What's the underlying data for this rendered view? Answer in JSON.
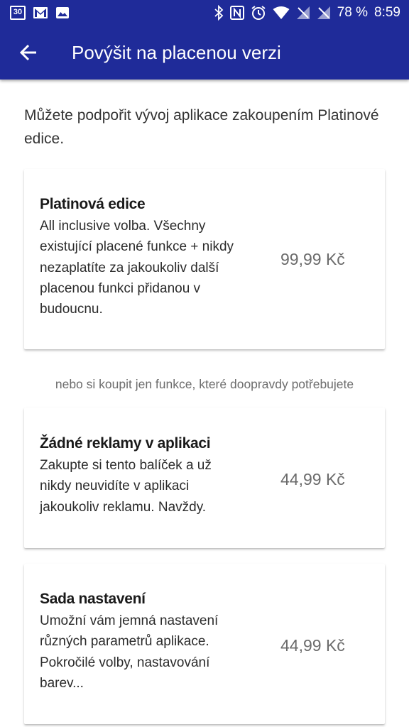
{
  "status_bar": {
    "calendar_day": "30",
    "icons_left": [
      "calendar-icon",
      "gmail-icon",
      "image-icon"
    ],
    "icons_right": [
      "bluetooth-icon",
      "nfc-icon",
      "alarm-icon",
      "wifi-icon",
      "signal-icon",
      "signal-icon",
      "battery-icon"
    ],
    "battery": "78 %",
    "time": "8:59"
  },
  "toolbar": {
    "back_icon": "arrow-back-icon",
    "title": "Povýšit na placenou verzi"
  },
  "intro_text": "Můžete podpořit vývoj aplikace zakoupením Platinové edice.",
  "separator_text": "nebo si koupit jen funkce, které doopravdy potřebujete",
  "products": [
    {
      "title": "Platinová edice",
      "description": "All inclusive volba. Všechny existující placené funkce + nikdy nezaplatíte za jakoukoliv další placenou funkci přidanou v budoucnu.",
      "price": "99,99 Kč"
    },
    {
      "title": "Žádné reklamy v aplikaci",
      "description": "Zakupte si tento balíček a už nikdy neuvidíte v aplikaci jakoukoliv reklamu. Navždy.",
      "price": "44,99 Kč"
    },
    {
      "title": "Sada nastavení",
      "description": "Umožní vám jemná nastavení různých parametrů aplikace. Pokročilé volby, nastavování barev...",
      "price": "44,99 Kč"
    }
  ],
  "colors": {
    "app_bar": "#1f2b99",
    "price_text": "#6b6b6b"
  }
}
